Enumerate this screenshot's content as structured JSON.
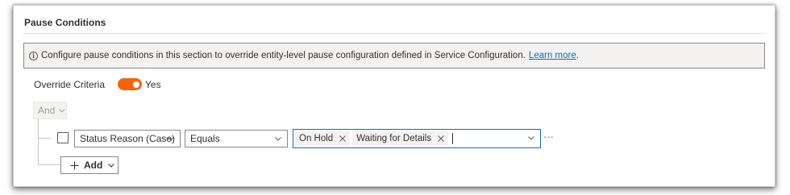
{
  "section": {
    "title": "Pause Conditions"
  },
  "info": {
    "text": "Configure pause conditions in this section to override entity-level pause configuration defined in Service Configuration.",
    "link": "Learn more",
    "trailing": "."
  },
  "override": {
    "label": "Override Criteria",
    "state": "Yes",
    "on": true
  },
  "group": {
    "operator": "And"
  },
  "condition": {
    "field": "Status Reason (Case)",
    "operator": "Equals",
    "values": [
      "On Hold",
      "Waiting for Details"
    ]
  },
  "actions": {
    "add_label": "Add",
    "more": "···"
  },
  "colors": {
    "accent": "#f7630c",
    "link": "#0f6cbd",
    "focus_border": "#0f6cbd"
  }
}
